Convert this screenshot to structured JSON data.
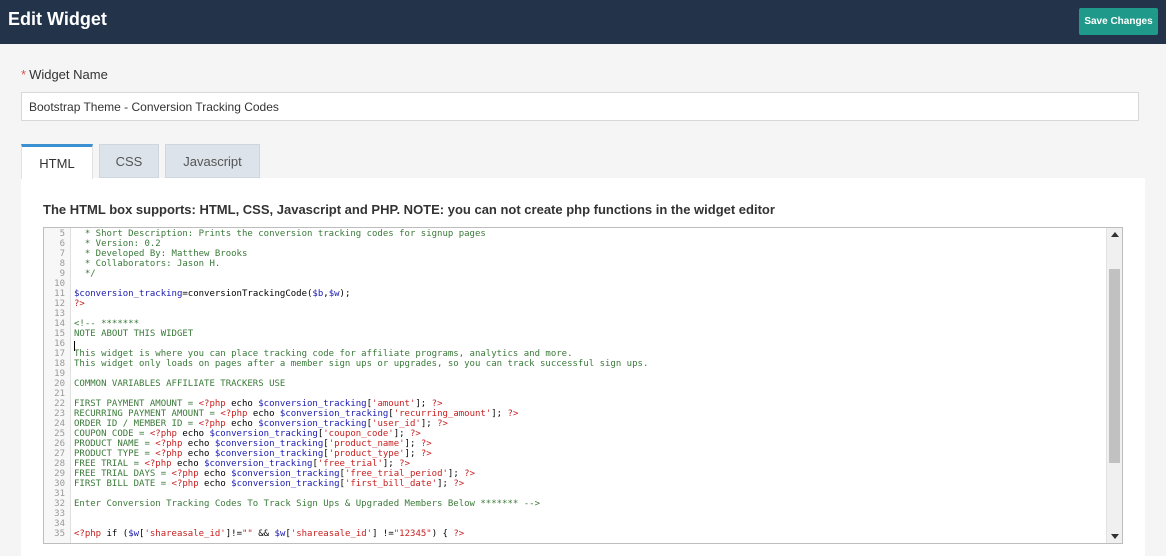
{
  "header": {
    "title": "Edit Widget",
    "save_label": "Save Changes"
  },
  "form": {
    "name_label": "Widget Name",
    "required_mark": "*",
    "name_value": "Bootstrap Theme - Conversion Tracking Codes"
  },
  "tabs": [
    {
      "label": "HTML"
    },
    {
      "label": "CSS"
    },
    {
      "label": "Javascript"
    }
  ],
  "panel": {
    "note": "The HTML box supports: HTML, CSS, Javascript and PHP. NOTE: you can not create php functions in the widget editor"
  },
  "editor": {
    "lines": [
      {
        "n": "5",
        "tokens": [
          {
            "t": "  * Short Description: Prints the conversion tracking codes for signup pages",
            "c": "com"
          }
        ]
      },
      {
        "n": "6",
        "tokens": [
          {
            "t": "  * Version: 0.2",
            "c": "com"
          }
        ]
      },
      {
        "n": "7",
        "tokens": [
          {
            "t": "  * Developed By: Matthew Brooks",
            "c": "com"
          }
        ]
      },
      {
        "n": "8",
        "tokens": [
          {
            "t": "  * Collaborators: Jason H.",
            "c": "com"
          }
        ]
      },
      {
        "n": "9",
        "tokens": [
          {
            "t": "  */",
            "c": "com"
          }
        ]
      },
      {
        "n": "10",
        "tokens": []
      },
      {
        "n": "11",
        "tokens": [
          {
            "t": "$conversion_tracking",
            "c": "var"
          },
          {
            "t": "=conversionTrackingCode(",
            "c": "plain"
          },
          {
            "t": "$b",
            "c": "var"
          },
          {
            "t": ",",
            "c": "plain"
          },
          {
            "t": "$w",
            "c": "var"
          },
          {
            "t": ");",
            "c": "plain"
          }
        ]
      },
      {
        "n": "12",
        "tokens": [
          {
            "t": "?>",
            "c": "php"
          }
        ]
      },
      {
        "n": "13",
        "tokens": []
      },
      {
        "n": "14",
        "tokens": [
          {
            "t": "<!-- *******",
            "c": "com"
          }
        ]
      },
      {
        "n": "15",
        "tokens": [
          {
            "t": "NOTE ABOUT THIS WIDGET",
            "c": "com"
          }
        ]
      },
      {
        "n": "16",
        "tokens": []
      },
      {
        "n": "17",
        "tokens": [
          {
            "t": "This widget is where you can place tracking code for affiliate programs, analytics and more.",
            "c": "com"
          }
        ]
      },
      {
        "n": "18",
        "tokens": [
          {
            "t": "This widget only loads on pages after a member sign ups or upgrades, so you can track successful sign ups.",
            "c": "com"
          }
        ]
      },
      {
        "n": "19",
        "tokens": []
      },
      {
        "n": "20",
        "tokens": [
          {
            "t": "COMMON VARIABLES AFFILIATE TRACKERS USE",
            "c": "com"
          }
        ]
      },
      {
        "n": "21",
        "tokens": []
      },
      {
        "n": "22",
        "tokens": [
          {
            "t": "FIRST PAYMENT AMOUNT = ",
            "c": "com"
          },
          {
            "t": "<?php",
            "c": "php"
          },
          {
            "t": " echo ",
            "c": "plain"
          },
          {
            "t": "$conversion_tracking",
            "c": "var"
          },
          {
            "t": "[",
            "c": "plain"
          },
          {
            "t": "'amount'",
            "c": "tag"
          },
          {
            "t": "]; ",
            "c": "plain"
          },
          {
            "t": "?>",
            "c": "php"
          }
        ]
      },
      {
        "n": "23",
        "tokens": [
          {
            "t": "RECURRING PAYMENT AMOUNT = ",
            "c": "com"
          },
          {
            "t": "<?php",
            "c": "php"
          },
          {
            "t": " echo ",
            "c": "plain"
          },
          {
            "t": "$conversion_tracking",
            "c": "var"
          },
          {
            "t": "[",
            "c": "plain"
          },
          {
            "t": "'recurring_amount'",
            "c": "tag"
          },
          {
            "t": "]; ",
            "c": "plain"
          },
          {
            "t": "?>",
            "c": "php"
          }
        ]
      },
      {
        "n": "24",
        "tokens": [
          {
            "t": "ORDER ID / MEMBER ID = ",
            "c": "com"
          },
          {
            "t": "<?php",
            "c": "php"
          },
          {
            "t": " echo ",
            "c": "plain"
          },
          {
            "t": "$conversion_tracking",
            "c": "var"
          },
          {
            "t": "[",
            "c": "plain"
          },
          {
            "t": "'user_id'",
            "c": "tag"
          },
          {
            "t": "]; ",
            "c": "plain"
          },
          {
            "t": "?>",
            "c": "php"
          }
        ]
      },
      {
        "n": "25",
        "tokens": [
          {
            "t": "COUPON CODE = ",
            "c": "com"
          },
          {
            "t": "<?php",
            "c": "php"
          },
          {
            "t": " echo ",
            "c": "plain"
          },
          {
            "t": "$conversion_tracking",
            "c": "var"
          },
          {
            "t": "[",
            "c": "plain"
          },
          {
            "t": "'coupon_code'",
            "c": "tag"
          },
          {
            "t": "]; ",
            "c": "plain"
          },
          {
            "t": "?>",
            "c": "php"
          }
        ]
      },
      {
        "n": "26",
        "tokens": [
          {
            "t": "PRODUCT NAME = ",
            "c": "com"
          },
          {
            "t": "<?php",
            "c": "php"
          },
          {
            "t": " echo ",
            "c": "plain"
          },
          {
            "t": "$conversion_tracking",
            "c": "var"
          },
          {
            "t": "[",
            "c": "plain"
          },
          {
            "t": "'product_name'",
            "c": "tag"
          },
          {
            "t": "]; ",
            "c": "plain"
          },
          {
            "t": "?>",
            "c": "php"
          }
        ]
      },
      {
        "n": "27",
        "tokens": [
          {
            "t": "PRODUCT TYPE = ",
            "c": "com"
          },
          {
            "t": "<?php",
            "c": "php"
          },
          {
            "t": " echo ",
            "c": "plain"
          },
          {
            "t": "$conversion_tracking",
            "c": "var"
          },
          {
            "t": "[",
            "c": "plain"
          },
          {
            "t": "'product_type'",
            "c": "tag"
          },
          {
            "t": "]; ",
            "c": "plain"
          },
          {
            "t": "?>",
            "c": "php"
          }
        ]
      },
      {
        "n": "28",
        "tokens": [
          {
            "t": "FREE TRIAL = ",
            "c": "com"
          },
          {
            "t": "<?php",
            "c": "php"
          },
          {
            "t": " echo ",
            "c": "plain"
          },
          {
            "t": "$conversion_tracking",
            "c": "var"
          },
          {
            "t": "[",
            "c": "plain"
          },
          {
            "t": "'free_trial'",
            "c": "tag"
          },
          {
            "t": "]; ",
            "c": "plain"
          },
          {
            "t": "?>",
            "c": "php"
          }
        ]
      },
      {
        "n": "29",
        "tokens": [
          {
            "t": "FREE TRIAL DAYS = ",
            "c": "com"
          },
          {
            "t": "<?php",
            "c": "php"
          },
          {
            "t": " echo ",
            "c": "plain"
          },
          {
            "t": "$conversion_tracking",
            "c": "var"
          },
          {
            "t": "[",
            "c": "plain"
          },
          {
            "t": "'free_trial_period'",
            "c": "tag"
          },
          {
            "t": "]; ",
            "c": "plain"
          },
          {
            "t": "?>",
            "c": "php"
          }
        ]
      },
      {
        "n": "30",
        "tokens": [
          {
            "t": "FIRST BILL DATE = ",
            "c": "com"
          },
          {
            "t": "<?php",
            "c": "php"
          },
          {
            "t": " echo ",
            "c": "plain"
          },
          {
            "t": "$conversion_tracking",
            "c": "var"
          },
          {
            "t": "[",
            "c": "plain"
          },
          {
            "t": "'first_bill_date'",
            "c": "tag"
          },
          {
            "t": "]; ",
            "c": "plain"
          },
          {
            "t": "?>",
            "c": "php"
          }
        ]
      },
      {
        "n": "31",
        "tokens": []
      },
      {
        "n": "32",
        "tokens": [
          {
            "t": "Enter Conversion Tracking Codes To Track Sign Ups & Upgraded Members Below ******* -->",
            "c": "com"
          }
        ]
      },
      {
        "n": "33",
        "tokens": []
      },
      {
        "n": "34",
        "tokens": []
      },
      {
        "n": "35",
        "tokens": [
          {
            "t": "<?php",
            "c": "php"
          },
          {
            "t": " if (",
            "c": "plain"
          },
          {
            "t": "$w",
            "c": "var"
          },
          {
            "t": "[",
            "c": "plain"
          },
          {
            "t": "'shareasale_id'",
            "c": "tag"
          },
          {
            "t": "]!=",
            "c": "plain"
          },
          {
            "t": "\"\"",
            "c": "tag"
          },
          {
            "t": " && ",
            "c": "plain"
          },
          {
            "t": "$w",
            "c": "var"
          },
          {
            "t": "[",
            "c": "plain"
          },
          {
            "t": "'shareasale_id'",
            "c": "tag"
          },
          {
            "t": "] !=",
            "c": "plain"
          },
          {
            "t": "\"12345\"",
            "c": "tag"
          },
          {
            "t": ") { ",
            "c": "plain"
          },
          {
            "t": "?>",
            "c": "php"
          }
        ]
      }
    ]
  }
}
